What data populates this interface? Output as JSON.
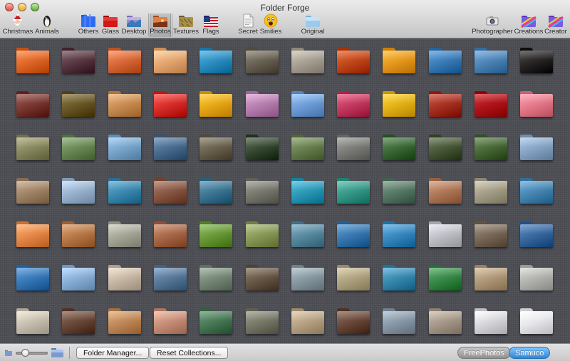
{
  "window": {
    "title": "Folder Forge"
  },
  "toolbar": {
    "items": [
      {
        "label": "Christmas",
        "icon": "santa-icon",
        "name": "toolbar-christmas"
      },
      {
        "label": "Animals",
        "icon": "penguin-icon",
        "name": "toolbar-animals"
      },
      {
        "label": "Others",
        "icon": "blue-folder-icon",
        "name": "toolbar-others"
      },
      {
        "label": "Glass",
        "icon": "red-folder-icon",
        "name": "toolbar-glass"
      },
      {
        "label": "Desktop",
        "icon": "desktop-folder-icon",
        "name": "toolbar-desktop"
      },
      {
        "label": "Photos",
        "icon": "photo-folder-icon",
        "name": "toolbar-photos",
        "selected": true
      },
      {
        "label": "Textures",
        "icon": "texture-folder-icon",
        "name": "toolbar-textures"
      },
      {
        "label": "Flags",
        "icon": "flag-folder-icon",
        "name": "toolbar-flags"
      },
      {
        "label": "Secret",
        "icon": "document-icon",
        "name": "toolbar-secret"
      },
      {
        "label": "Smilies",
        "icon": "smiley-icon",
        "name": "toolbar-smilies"
      },
      {
        "label": "Original",
        "icon": "plain-folder-icon",
        "name": "toolbar-original"
      },
      {
        "label": "Photographer",
        "icon": "camera-icon",
        "name": "toolbar-photographer"
      },
      {
        "label": "Creations",
        "icon": "palette-folder-icon",
        "name": "toolbar-creations"
      },
      {
        "label": "Creator",
        "icon": "palette-folder-icon",
        "name": "toolbar-creator"
      }
    ]
  },
  "grid": {
    "rows": [
      [
        "#e0692a",
        "#5a3a44",
        "#d96a3a",
        "#e5a872",
        "#2f8fc0",
        "#6b6456",
        "#a9a294",
        "#c24a1c",
        "#e69a1f",
        "#3d7db8",
        "#4f86b8",
        "#2a2626"
      ],
      [
        "#7b3a34",
        "#6b5a2a",
        "#c98e54",
        "#d8302c",
        "#e8a818",
        "#b880b0",
        "#6f9ed8",
        "#c43c62",
        "#e4b218",
        "#a83424",
        "#b0141a",
        "#e47a8a"
      ],
      [
        "#8a8a62",
        "#6b8a58",
        "#7aa6cc",
        "#4c6e90",
        "#6c6450",
        "#384a34",
        "#6a8050",
        "#7e7e7a",
        "#3e6a3a",
        "#4a5a3a",
        "#4a6a3a",
        "#8aa6c6"
      ],
      [
        "#a2866a",
        "#9ab4d0",
        "#3e8ab0",
        "#8a5a46",
        "#3e7894",
        "#7a7a70",
        "#2e9ab8",
        "#3a9a8a",
        "#5a7a68",
        "#b07a5a",
        "#a6a08a",
        "#4a88b4"
      ],
      [
        "#e58a4a",
        "#b87a4a",
        "#a8a89a",
        "#a86a4a",
        "#6a9a3a",
        "#8a9a5a",
        "#5a8aa0",
        "#3a7ab0",
        "#3a8ac0",
        "#c0c0c8",
        "#7a6a5a",
        "#3a6aa0"
      ],
      [
        "#3a7ab8",
        "#8ab0d8",
        "#c8b8a6",
        "#5a7a9a",
        "#7a8a7a",
        "#6a5a4a",
        "#8a9aa2",
        "#b0a482",
        "#3a8ab0",
        "#3a8a4a",
        "#b09a7a",
        "#b4b4b0"
      ],
      [
        "#c8c0b0",
        "#6a4a3a",
        "#c08a5a",
        "#c8907a",
        "#4a7a58",
        "#7a7a6a",
        "#b8a484",
        "#6a4a3a",
        "#8a9aa8",
        "#a89a8a",
        "#d8d8dc",
        "#e8e8ec"
      ]
    ]
  },
  "bottombar": {
    "zoom_level": 0.2,
    "folder_manager_label": "Folder Manager...",
    "reset_collections_label": "Reset Collections...",
    "freephotos_label": "FreePhotos",
    "samuco_label": "Samuco"
  }
}
